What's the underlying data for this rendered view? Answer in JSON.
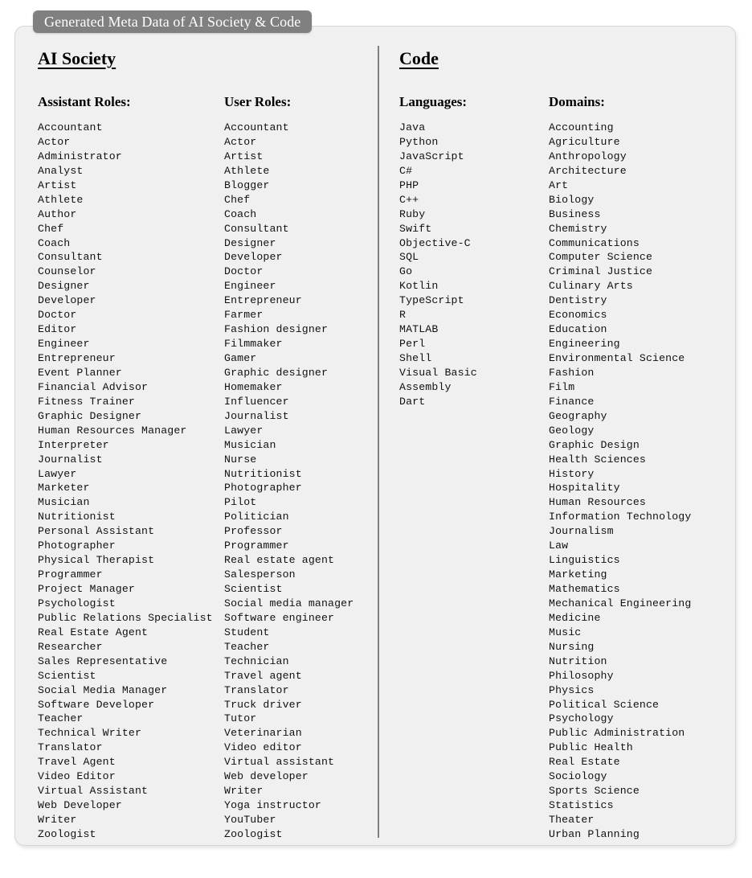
{
  "title_bar": {
    "label": "Generated Meta Data of AI Society & Code"
  },
  "sections": {
    "ai_society": {
      "heading": "AI Society",
      "assistant_roles": {
        "header": "Assistant Roles:",
        "items": [
          "Accountant",
          "Actor",
          "Administrator",
          "Analyst",
          "Artist",
          "Athlete",
          "Author",
          "Chef",
          "Coach",
          "Consultant",
          "Counselor",
          "Designer",
          "Developer",
          "Doctor",
          "Editor",
          "Engineer",
          "Entrepreneur",
          "Event Planner",
          "Financial Advisor",
          "Fitness Trainer",
          "Graphic Designer",
          "Human Resources Manager",
          "Interpreter",
          "Journalist",
          "Lawyer",
          "Marketer",
          "Musician",
          "Nutritionist",
          "Personal Assistant",
          "Photographer",
          "Physical Therapist",
          "Programmer",
          "Project Manager",
          "Psychologist",
          "Public Relations Specialist",
          "Real Estate Agent",
          "Researcher",
          "Sales Representative",
          "Scientist",
          "Social Media Manager",
          "Software Developer",
          "Teacher",
          "Technical Writer",
          "Translator",
          "Travel Agent",
          "Video Editor",
          "Virtual Assistant",
          "Web Developer",
          "Writer",
          "Zoologist"
        ]
      },
      "user_roles": {
        "header": "User Roles:",
        "items": [
          "Accountant",
          "Actor",
          "Artist",
          "Athlete",
          "Blogger",
          "Chef",
          "Coach",
          "Consultant",
          "Designer",
          "Developer",
          "Doctor",
          "Engineer",
          "Entrepreneur",
          "Farmer",
          "Fashion designer",
          "Filmmaker",
          "Gamer",
          "Graphic designer",
          "Homemaker",
          "Influencer",
          "Journalist",
          "Lawyer",
          "Musician",
          "Nurse",
          "Nutritionist",
          "Photographer",
          "Pilot",
          "Politician",
          "Professor",
          "Programmer",
          "Real estate agent",
          "Salesperson",
          "Scientist",
          "Social media manager",
          "Software engineer",
          "Student",
          "Teacher",
          "Technician",
          "Travel agent",
          "Translator",
          "Truck driver",
          "Tutor",
          "Veterinarian",
          "Video editor",
          "Virtual assistant",
          "Web developer",
          "Writer",
          "Yoga instructor",
          "YouTuber",
          "Zoologist"
        ]
      }
    },
    "code": {
      "heading": "Code",
      "languages": {
        "header": "Languages:",
        "items": [
          "Java",
          "Python",
          "JavaScript",
          "C#",
          "PHP",
          "C++",
          "Ruby",
          "Swift",
          "Objective-C",
          "SQL",
          "Go",
          "Kotlin",
          "TypeScript",
          "R",
          "MATLAB",
          "Perl",
          "Shell",
          "Visual Basic",
          "Assembly",
          "Dart"
        ]
      },
      "domains": {
        "header": "Domains:",
        "items": [
          "Accounting",
          "Agriculture",
          "Anthropology",
          "Architecture",
          "Art",
          "Biology",
          "Business",
          "Chemistry",
          "Communications",
          "Computer Science",
          "Criminal Justice",
          "Culinary Arts",
          "Dentistry",
          "Economics",
          "Education",
          "Engineering",
          "Environmental Science",
          "Fashion",
          "Film",
          "Finance",
          "Geography",
          "Geology",
          "Graphic Design",
          "Health Sciences",
          "History",
          "Hospitality",
          "Human Resources",
          "Information Technology",
          "Journalism",
          "Law",
          "Linguistics",
          "Marketing",
          "Mathematics",
          "Mechanical Engineering",
          "Medicine",
          "Music",
          "Nursing",
          "Nutrition",
          "Philosophy",
          "Physics",
          "Political Science",
          "Psychology",
          "Public Administration",
          "Public Health",
          "Real Estate",
          "Sociology",
          "Sports Science",
          "Statistics",
          "Theater",
          "Urban Planning"
        ]
      }
    }
  },
  "colors": {
    "title_bar_background": "#808080",
    "title_bar_text": "#ffffff",
    "panel_background": "#f0f0f0",
    "panel_border": "#d6d6d6",
    "divider": "#7f7f7f",
    "text": "#111111"
  }
}
